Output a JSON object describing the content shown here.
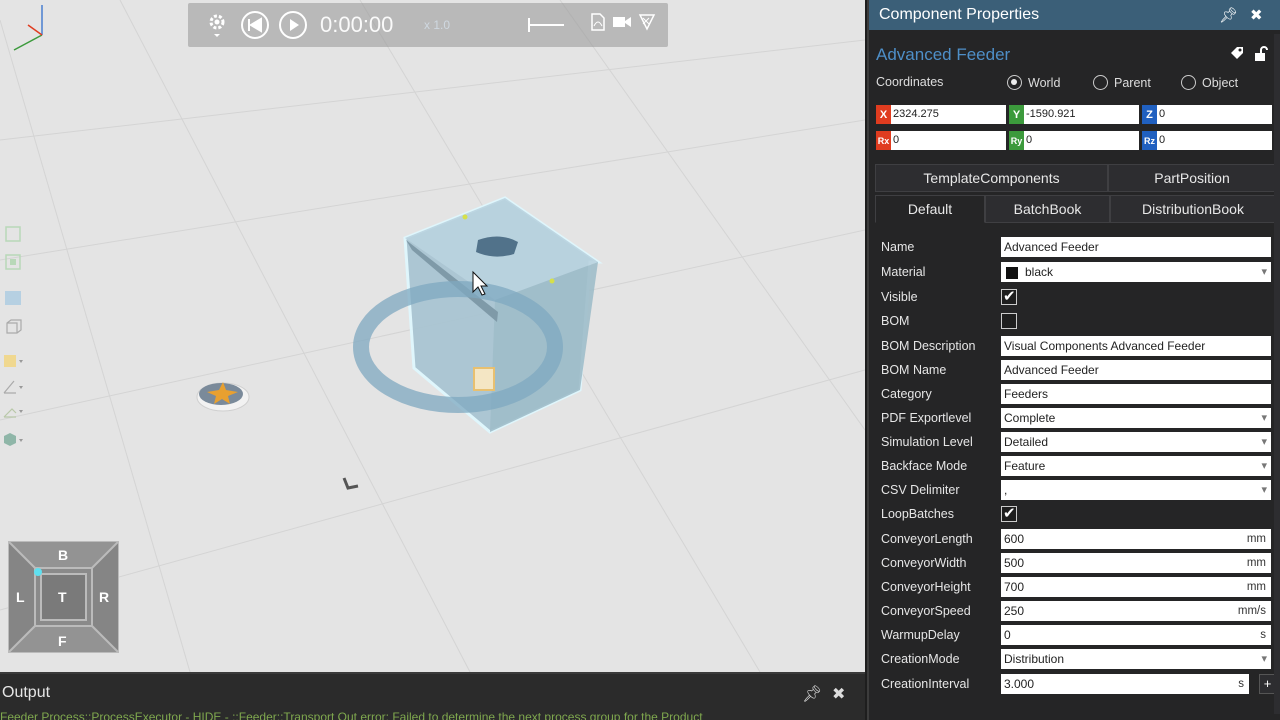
{
  "playback": {
    "time": "0:00:00",
    "speed": "x 1.0",
    "icons": [
      "gear-icon",
      "rewind-icon",
      "play-icon",
      "pdf-icon",
      "video-camera-icon",
      "signal-icon"
    ]
  },
  "navcube": {
    "top": "B",
    "left": "L",
    "center": "T",
    "right": "R",
    "bottom": "F"
  },
  "output": {
    "title": "Output",
    "log_line": "Feeder Process::ProcessExecutor - HIDE - ::Feeder::Transport Out error: Failed to determine the next process group for the Product"
  },
  "properties": {
    "panel_title": "Component Properties",
    "component_name": "Advanced Feeder",
    "coordinates_label": "Coordinates",
    "coord_modes": [
      {
        "label": "World",
        "selected": true
      },
      {
        "label": "Parent",
        "selected": false
      },
      {
        "label": "Object",
        "selected": false
      }
    ],
    "coords": {
      "x": {
        "tag": "X",
        "value": "2324.275",
        "color": "#e03c1f"
      },
      "y": {
        "tag": "Y",
        "value": "-1590.921",
        "color": "#3c9a3c"
      },
      "z": {
        "tag": "Z",
        "value": "0",
        "color": "#2060c0"
      },
      "rx": {
        "tag": "Rx",
        "value": "0",
        "color": "#e03c1f"
      },
      "ry": {
        "tag": "Ry",
        "value": "0",
        "color": "#3c9a3c"
      },
      "rz": {
        "tag": "Rz",
        "value": "0",
        "color": "#2060c0"
      }
    },
    "tabs_row1": [
      "TemplateComponents",
      "PartPosition"
    ],
    "tabs_row2": [
      "Default",
      "BatchBook",
      "DistributionBook"
    ],
    "active_tab": "Default",
    "rows": [
      {
        "label": "Name",
        "value": "Advanced Feeder",
        "kind": "text"
      },
      {
        "label": "Material",
        "value": "black",
        "kind": "material"
      },
      {
        "label": "Visible",
        "checked": true,
        "kind": "check"
      },
      {
        "label": "BOM",
        "checked": false,
        "kind": "check"
      },
      {
        "label": "BOM Description",
        "value": "Visual Components Advanced Feeder",
        "kind": "text"
      },
      {
        "label": "BOM Name",
        "value": "Advanced Feeder",
        "kind": "text"
      },
      {
        "label": "Category",
        "value": "Feeders",
        "kind": "text"
      },
      {
        "label": "PDF Exportlevel",
        "value": "Complete",
        "kind": "dropdown"
      },
      {
        "label": "Simulation Level",
        "value": "Detailed",
        "kind": "dropdown"
      },
      {
        "label": "Backface Mode",
        "value": "Feature",
        "kind": "dropdown"
      },
      {
        "label": "CSV Delimiter",
        "value": ",",
        "kind": "dropdown"
      },
      {
        "label": "LoopBatches",
        "checked": true,
        "kind": "check"
      },
      {
        "label": "ConveyorLength",
        "value": "600",
        "unit": "mm",
        "kind": "unit"
      },
      {
        "label": "ConveyorWidth",
        "value": "500",
        "unit": "mm",
        "kind": "unit"
      },
      {
        "label": "ConveyorHeight",
        "value": "700",
        "unit": "mm",
        "kind": "unit"
      },
      {
        "label": "ConveyorSpeed",
        "value": "250",
        "unit": "mm/s",
        "kind": "unit"
      },
      {
        "label": "WarmupDelay",
        "value": "0",
        "unit": "s",
        "kind": "unit"
      },
      {
        "label": "CreationMode",
        "value": "Distribution",
        "kind": "dropdown"
      },
      {
        "label": "CreationInterval",
        "value": "3.000",
        "unit": "s",
        "kind": "unit-plus",
        "button": "+"
      }
    ]
  }
}
